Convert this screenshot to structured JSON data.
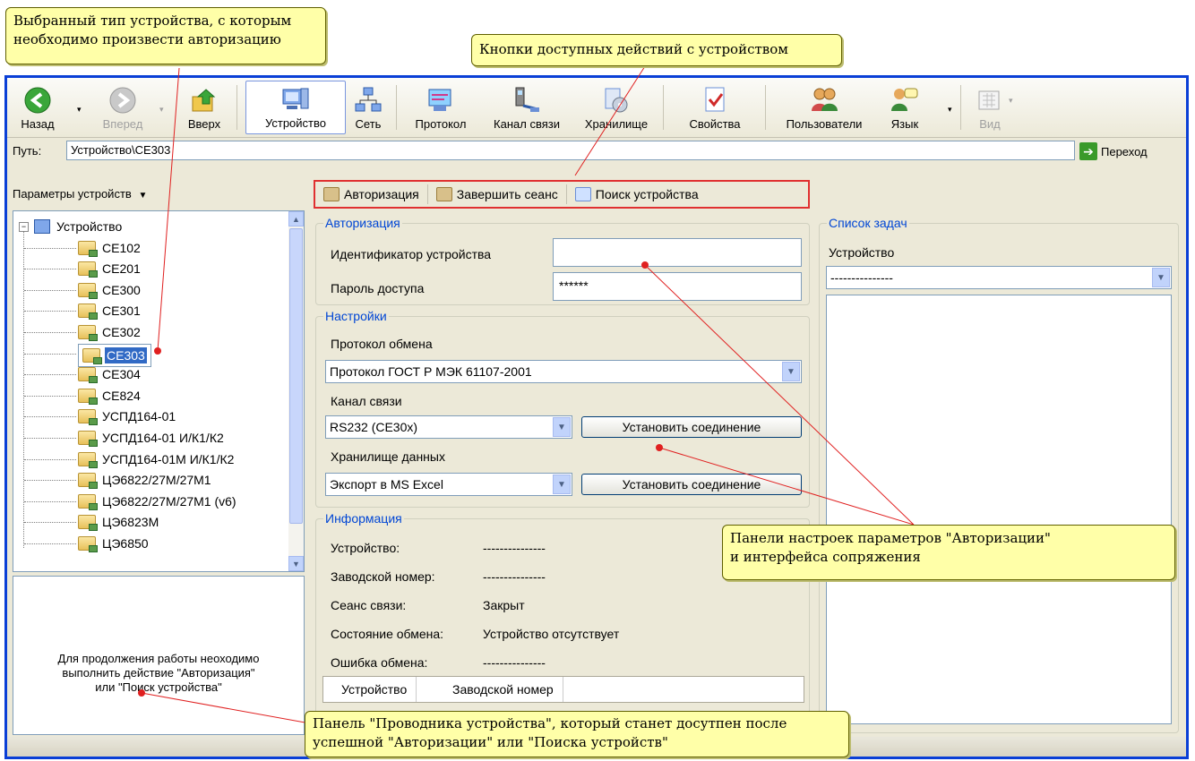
{
  "callouts": {
    "selected_type": [
      "Выбранный тип устройства, с которым",
      "необходимо произвести авторизацию"
    ],
    "actions": "Кнопки доступных действий с устройством",
    "panels": [
      "Панели настроек параметров \"Авторизации\"",
      "и интерфейса сопряжения"
    ],
    "explorer": [
      "Панель \"Проводника устройства\", который станет досутпен после",
      "успешной \"Авторизации\" или \"Поиска устройств\""
    ]
  },
  "toolbar": {
    "back": "Назад",
    "forward": "Вперед",
    "up": "Вверх",
    "device": "Устройство",
    "network": "Сеть",
    "protocol": "Протокол",
    "channel": "Канал связи",
    "storage": "Хранилище",
    "properties": "Свойства",
    "users": "Пользователи",
    "language": "Язык",
    "view": "Вид"
  },
  "path": {
    "label": "Путь:",
    "value": "Устройство\\CE303",
    "go": "Переход"
  },
  "left": {
    "params_header": "Параметры устройств",
    "tree_root": "Устройство",
    "tree_items": [
      "CE102",
      "CE201",
      "CE300",
      "CE301",
      "CE302",
      "CE303",
      "CE304",
      "CE824",
      "УСПД164-01",
      "УСПД164-01 И/К1/К2",
      "УСПД164-01М И/К1/К2",
      "ЦЭ6822/27М/27М1",
      "ЦЭ6822/27М/27М1 (v6)",
      "ЦЭ6823М",
      "ЦЭ6850"
    ],
    "selected": "CE303",
    "info": [
      "Для продолжения работы неоходимо",
      "выполнить действие \"Авторизация\"",
      "или \"Поиск устройства\""
    ]
  },
  "actions": {
    "auth": "Авторизация",
    "end_session": "Завершить сеанс",
    "search": "Поиск устройства"
  },
  "auth_group": {
    "title": "Авторизация",
    "id_label": "Идентификатор устройства",
    "id_value": "",
    "pwd_label": "Пароль доступа",
    "pwd_value": "******"
  },
  "settings_group": {
    "title": "Настройки",
    "protocol_label": "Протокол обмена",
    "protocol_value": "Протокол ГОСТ Р МЭК 61107-2001",
    "channel_label": "Канал связи",
    "channel_value": "RS232 (CE30x)",
    "connect_btn": "Установить соединение",
    "storage_label": "Хранилище данных",
    "storage_value": "Экспорт в MS Excel",
    "connect_btn2": "Установить соединение"
  },
  "info_group": {
    "title": "Информация",
    "rows": [
      {
        "label": "Устройство:",
        "value": "---------------"
      },
      {
        "label": "Заводской номер:",
        "value": "---------------"
      },
      {
        "label": "Сеанс связи:",
        "value": "Закрыт"
      },
      {
        "label": "Состояние обмена:",
        "value": "Устройство отсутствует"
      },
      {
        "label": "Ошибка обмена:",
        "value": "---------------"
      }
    ],
    "grid_cols": [
      "Устройство",
      "Заводской номер"
    ]
  },
  "tasks_group": {
    "title": "Список задач",
    "device_label": "Устройство",
    "device_value": "---------------"
  }
}
